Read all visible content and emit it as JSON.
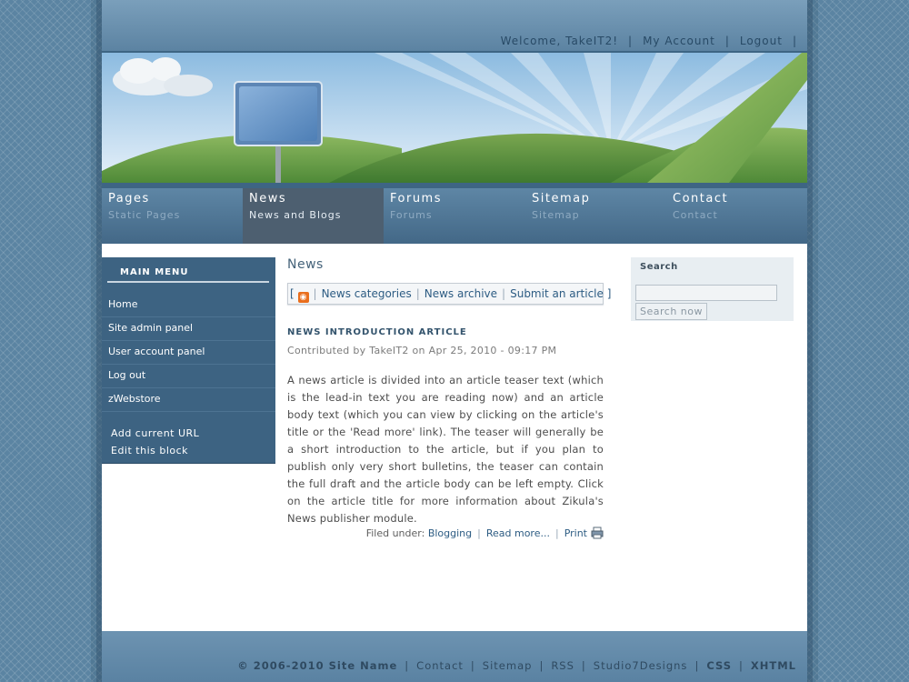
{
  "user_nav": {
    "welcome": "Welcome, TakeIT2!",
    "account": "My Account",
    "logout": "Logout",
    "separator": "|"
  },
  "main_nav": [
    {
      "title": "Pages",
      "subtitle": "Static Pages",
      "active": false
    },
    {
      "title": "News",
      "subtitle": "News and Blogs",
      "active": true
    },
    {
      "title": "Forums",
      "subtitle": "Forums",
      "active": false
    },
    {
      "title": "Sitemap",
      "subtitle": "Sitemap",
      "active": false
    },
    {
      "title": "Contact",
      "subtitle": "Contact",
      "active": false
    }
  ],
  "left_menu": {
    "heading": "MAIN MENU",
    "items": [
      "Home",
      "Site admin panel",
      "User account panel",
      "Log out",
      "zWebstore"
    ],
    "extra": [
      "Add current URL",
      "Edit this block"
    ]
  },
  "content": {
    "heading": "News",
    "newsbar": {
      "open": "[",
      "close": "]",
      "sep": "|",
      "rss_icon": "rss-icon",
      "categories": "News categories",
      "archive": "News archive",
      "submit": "Submit an article"
    },
    "article": {
      "title": "NEWS INTRODUCTION ARTICLE",
      "meta": "Contributed by TakeIT2 on Apr 25, 2010 - 09:17 PM",
      "body": "A news article is divided into an article teaser text (which is the lead-in text you are reading now) and an article body text (which you can view by clicking on the article's title or the 'Read more' link). The teaser will generally be a short introduction to the article, but if you plan to publish only very short bulletins, the teaser can contain the full draft and the article body can be left empty. Click on the article title for more information about Zikula's News publisher module.",
      "filed_under_label": "Filed under:",
      "category": "Blogging",
      "read_more": "Read more...",
      "print": "Print",
      "sep": "|",
      "print_icon": "printer-icon"
    }
  },
  "search": {
    "label": "Search",
    "value": "",
    "button": "Search now"
  },
  "footer": {
    "copyright": "© 2006-2010 Site Name",
    "links": [
      "Contact",
      "Sitemap",
      "RSS",
      "Studio7Designs"
    ],
    "css": "CSS",
    "xhtml": "XHTML",
    "sep": "|"
  },
  "colors": {
    "page_bg": "#5b84a2",
    "nav_bg": "#436887",
    "active_nav": "#4d5f70",
    "menu_bg": "#3d6382",
    "link": "#2d5c83"
  }
}
